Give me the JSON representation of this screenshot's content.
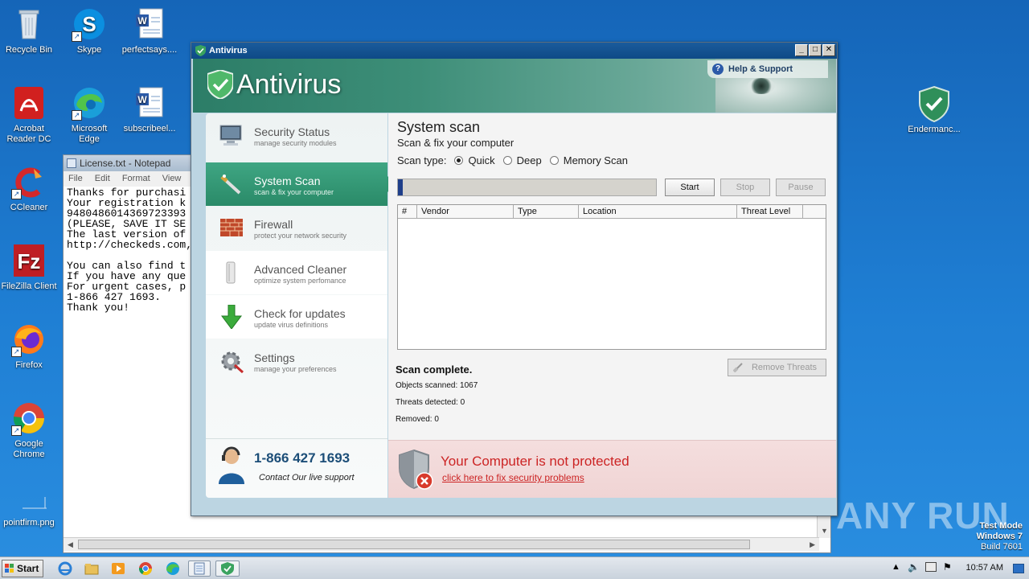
{
  "desktop": {
    "icons": [
      {
        "label": "Recycle Bin",
        "icon": "recycle-bin-icon"
      },
      {
        "label": "Skype",
        "icon": "skype-icon"
      },
      {
        "label": "perfectsays....",
        "icon": "word-document-icon"
      },
      {
        "label": "Acrobat Reader DC",
        "icon": "acrobat-icon"
      },
      {
        "label": "Microsoft Edge",
        "icon": "edge-icon"
      },
      {
        "label": "subscribeel...",
        "icon": "word-document-icon"
      },
      {
        "label": "CCleaner",
        "icon": "ccleaner-icon"
      },
      {
        "label": "FileZilla Client",
        "icon": "filezilla-icon"
      },
      {
        "label": "Firefox",
        "icon": "firefox-icon"
      },
      {
        "label": "Google Chrome",
        "icon": "chrome-icon"
      },
      {
        "label": "pointfirm.png",
        "icon": "image-file-icon"
      },
      {
        "label": "Endermanc...",
        "icon": "shield-icon"
      }
    ],
    "watermark": "ANY RUN",
    "test_mode": {
      "line1": "Test Mode",
      "line2": "Windows 7",
      "line3": "Build 7601"
    }
  },
  "notepad": {
    "title": "License.txt - Notepad",
    "menu": [
      "File",
      "Edit",
      "Format",
      "View",
      "He"
    ],
    "text": "Thanks for purchasi\nYour registration k\n9480486014369723393\n(PLEASE, SAVE IT SE\nThe last version of\nhttp://checkeds.com,\n\nYou can also find t\nIf you have any que\nFor urgent cases, p\n1-866 427 1693.\nThank you!"
  },
  "antivirus": {
    "window_title": "Antivirus",
    "logo_text": "Antivirus",
    "help": "Help & Support",
    "nav": [
      {
        "title": "Security Status",
        "subtitle": "manage security modules",
        "icon": "monitor-icon"
      },
      {
        "title": "System Scan",
        "subtitle": "scan & fix your computer",
        "icon": "scan-wand-icon"
      },
      {
        "title": "Firewall",
        "subtitle": "protect your network security",
        "icon": "firewall-icon"
      },
      {
        "title": "Advanced Cleaner",
        "subtitle": "optimize system perfomance",
        "icon": "cleaner-icon"
      },
      {
        "title": "Check for updates",
        "subtitle": "update virus definitions",
        "icon": "download-arrow-icon"
      },
      {
        "title": "Settings",
        "subtitle": "manage your preferences",
        "icon": "settings-gear-icon"
      }
    ],
    "support": {
      "phone": "1-866 427 1693",
      "caption": "Contact Our live support"
    },
    "scan": {
      "title": "System scan",
      "subtitle": "Scan & fix your computer",
      "scan_type_label": "Scan type:",
      "options": [
        "Quick",
        "Deep",
        "Memory Scan"
      ],
      "selected": "Quick",
      "progress": 0.02,
      "buttons": {
        "start": "Start",
        "stop": "Stop",
        "pause": "Pause"
      },
      "columns": [
        "#",
        "Vendor",
        "Type",
        "Location",
        "Threat Level"
      ],
      "status": "Scan complete.",
      "objects_scanned": "Objects scanned: 1067",
      "threats_detected": "Threats detected: 0",
      "removed": "Removed: 0",
      "remove_button": "Remove Threats"
    },
    "warning": {
      "title": "Your Computer is not protected",
      "link": "click here to fix security problems"
    }
  },
  "taskbar": {
    "start": "Start",
    "clock": "10:57 AM"
  }
}
